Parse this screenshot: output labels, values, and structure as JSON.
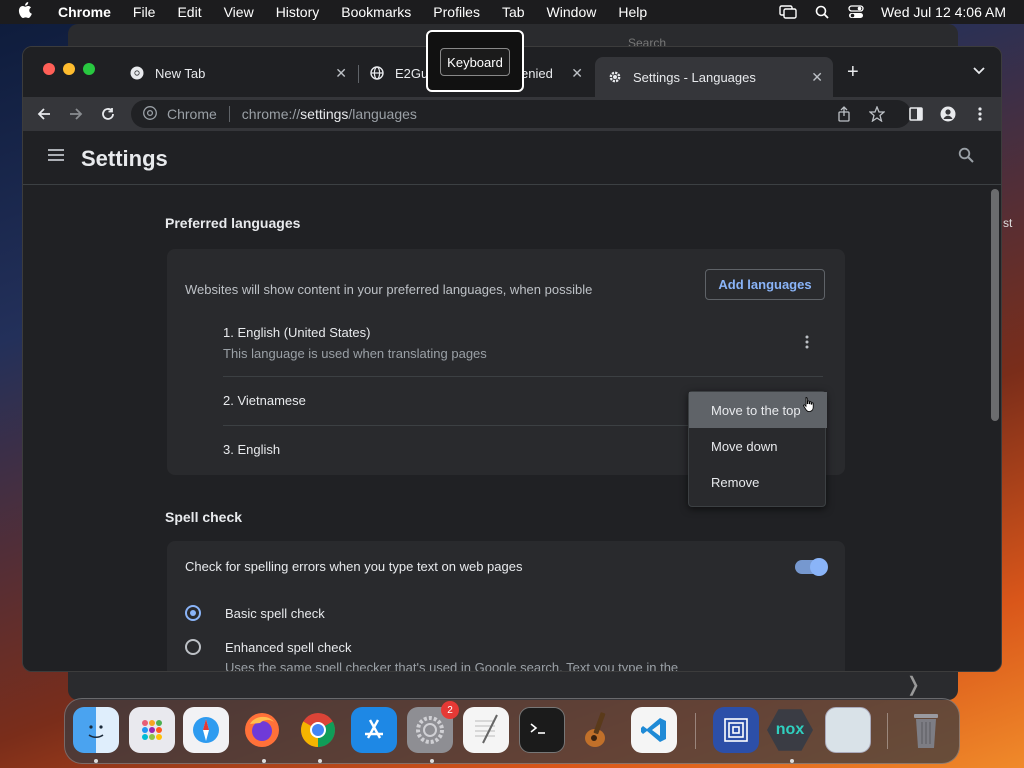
{
  "menubar": {
    "app": "Chrome",
    "items": [
      "File",
      "Edit",
      "View",
      "History",
      "Bookmarks",
      "Profiles",
      "Tab",
      "Window",
      "Help"
    ],
    "datetime": "Wed Jul 12  4:06 AM"
  },
  "background": {
    "search_placeholder": "Search",
    "right_text": "st"
  },
  "tooltip": {
    "label": "Keyboard"
  },
  "tabs": [
    {
      "title": "New Tab",
      "icon": "chrome-icon"
    },
    {
      "title": "E2Gua",
      "suffix": "enied",
      "icon": "globe-icon"
    },
    {
      "title": "Settings - Languages",
      "icon": "gear-icon",
      "active": true
    }
  ],
  "omnibox": {
    "site_name": "Chrome",
    "url_scheme": "chrome://",
    "url_host": "settings",
    "url_path": "/languages"
  },
  "settings": {
    "title": "Settings",
    "preferred_languages": {
      "heading": "Preferred languages",
      "description": "Websites will show content in your preferred languages, when possible",
      "add_button": "Add languages",
      "languages": [
        {
          "name": "1. English (United States)",
          "sub": "This language is used when translating pages"
        },
        {
          "name": "2. Vietnamese"
        },
        {
          "name": "3. English"
        }
      ]
    },
    "context_menu": {
      "items": [
        "Move to the top",
        "Move down",
        "Remove"
      ]
    },
    "spell_check": {
      "heading": "Spell check",
      "toggle_label": "Check for spelling errors when you type text on web pages",
      "toggle_on": true,
      "options": [
        {
          "label": "Basic spell check",
          "checked": true
        },
        {
          "label": "Enhanced spell check",
          "checked": false,
          "sub": "Uses the same spell checker that's used in Google search. Text you type in the"
        }
      ]
    }
  },
  "dock": {
    "apps": [
      "Finder",
      "Launchpad",
      "Safari",
      "Firefox",
      "Chrome",
      "App Store",
      "System Settings",
      "TextEdit",
      "Terminal",
      "GarageBand",
      "VS Code",
      "Screens",
      "Nox",
      "Preview",
      "Trash"
    ],
    "system_settings_badge": "2"
  },
  "colors": {
    "accent": "#8ab4f8",
    "page_bg": "#202124",
    "card_bg": "#292a2d"
  }
}
